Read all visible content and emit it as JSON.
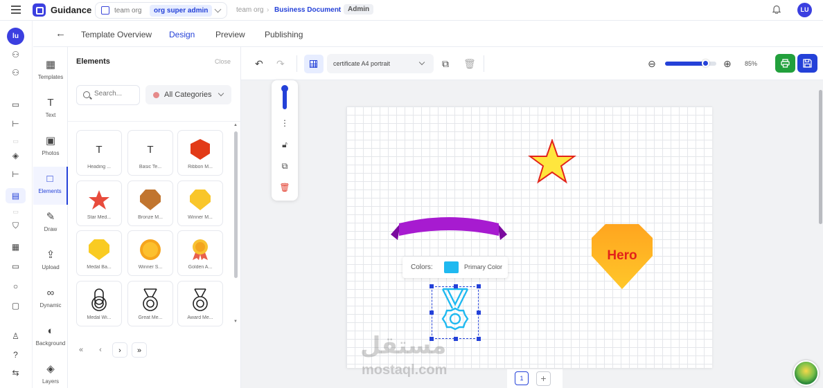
{
  "app": {
    "name": "Guidance"
  },
  "org": {
    "label": "team org",
    "role": "org super admin"
  },
  "breadcrumb": {
    "item1": "team org",
    "item2": "Business Document",
    "badge": "Admin"
  },
  "user": {
    "initials": "LU",
    "rail_initials": "lu"
  },
  "tabs": [
    "Template Overview",
    "Design",
    "Preview",
    "Publishing"
  ],
  "tools": [
    "Templates",
    "Text",
    "Photos",
    "Elements",
    "Draw",
    "Upload",
    "Dynamic",
    "Background",
    "Layers"
  ],
  "panel": {
    "title": "Elements",
    "close": "Close",
    "search_placeholder": "Search...",
    "category": "All Categories",
    "items": [
      "Heading ...",
      "Basic Te...",
      "Ribbon M...",
      "Star Med...",
      "Bronze M...",
      "Winner M...",
      "Medal Ba...",
      "Winner S...",
      "Golden A...",
      "Medal Wi...",
      "Great Me...",
      "Award Me..."
    ],
    "text_glyph": "T"
  },
  "toolbar": {
    "template": "certificate A4 portrait",
    "zoom": "85%",
    "zoom_level": 0.8
  },
  "canvas": {
    "hero_text": "Hero",
    "color_label": "Colors:",
    "color_name": "Primary Color",
    "color_value": "#1fb9f0",
    "page_number": "1"
  },
  "watermark": {
    "ar": "مستقل",
    "en": "mostaql.com"
  },
  "colors": {
    "accent": "#2441d8",
    "green": "#22a03c",
    "star": "#ffe63d",
    "ribbon": "#a71bd0",
    "hero": "#ffb21f"
  }
}
